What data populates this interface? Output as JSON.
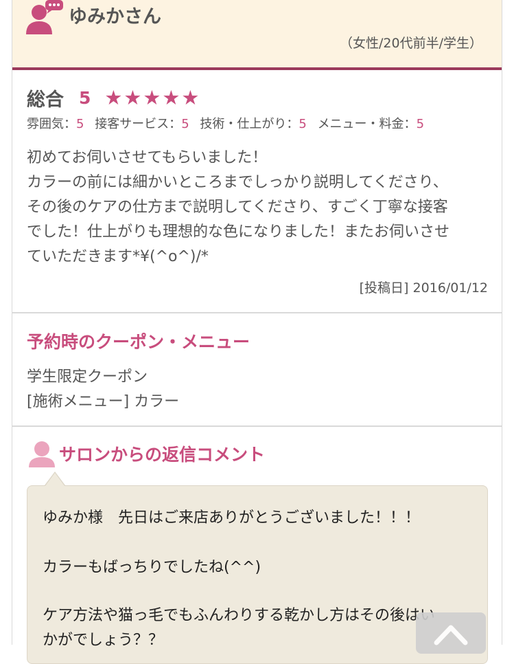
{
  "reviewer": {
    "name": "ゆみかさん",
    "meta": "（女性/20代前半/学生）"
  },
  "review": {
    "overall_label": "総合",
    "overall_score": "5",
    "stars": "★★★★★",
    "subscores": [
      {
        "label": "雰囲気：",
        "value": "5"
      },
      {
        "label": "接客サービス：",
        "value": "5"
      },
      {
        "label": "技術・仕上がり：",
        "value": "5"
      },
      {
        "label": "メニュー・料金：",
        "value": "5"
      }
    ],
    "body_lines": [
      "初めてお伺いさせてもらいました！",
      "カラーの前には細かいところまでしっかり説明してくださり、",
      "その後のケアの仕方まで説明してくださり、すごく丁寧な接客",
      "でした！仕上がりも理想的な色になりました！またお伺いさせ",
      "ていただきます*¥(^o^)/*"
    ],
    "posted": "[投稿日] 2016/01/12"
  },
  "coupon": {
    "title": "予約時のクーポン・メニュー",
    "coupon_name": "学生限定クーポン",
    "menu": "[施術メニュー] カラー"
  },
  "reply": {
    "title": "サロンからの返信コメント",
    "paragraphs": [
      "ゆみか様　先日はご来店ありがとうございました！！！",
      "カラーもばっちりでしたね(^^)",
      "ケア方法や猫っ毛でもふんわりする乾かし方はその後はい",
      "かがでしょう？？"
    ]
  },
  "colors": {
    "accent": "#c84d7d",
    "header_bg": "#fdf3e1",
    "divider": "#9b3a5c",
    "bubble_bg": "#efeadd"
  },
  "icons": {
    "reviewer": "user-chat-icon",
    "salon": "user-icon",
    "to_top": "chevron-up-icon"
  }
}
